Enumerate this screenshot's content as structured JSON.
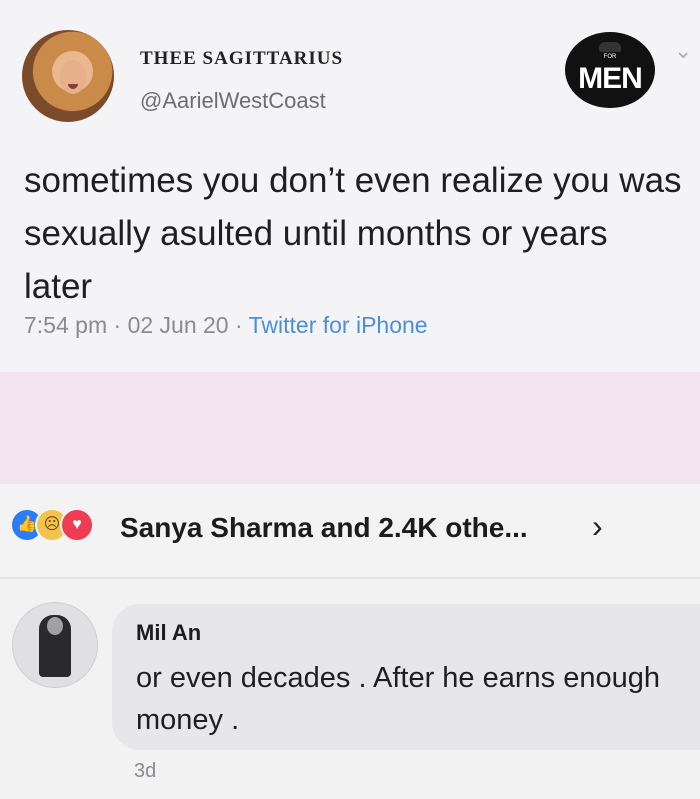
{
  "tweet": {
    "name": "THEE SAGITTARIUS",
    "handle": "@AarielWestCoast",
    "text": "sometimes you don’t even realize you was sexually asulted until months or years later",
    "time": "7:54 pm",
    "date": "02 Jun 20",
    "source": "Twitter for iPhone",
    "brand_small": "FOR",
    "brand": "MEN"
  },
  "reactions": {
    "text": "Sanya Sharma and 2.4K othe...",
    "icons": [
      "like-icon",
      "sad-icon",
      "love-icon"
    ]
  },
  "comment": {
    "author": "Mil An",
    "text": "or even decades . After he earns enough money .",
    "time": "3d"
  },
  "colors": {
    "link": "#4a90d9",
    "like": "#2b7cf6",
    "love": "#ee3c52",
    "sad": "#f3c44d"
  }
}
